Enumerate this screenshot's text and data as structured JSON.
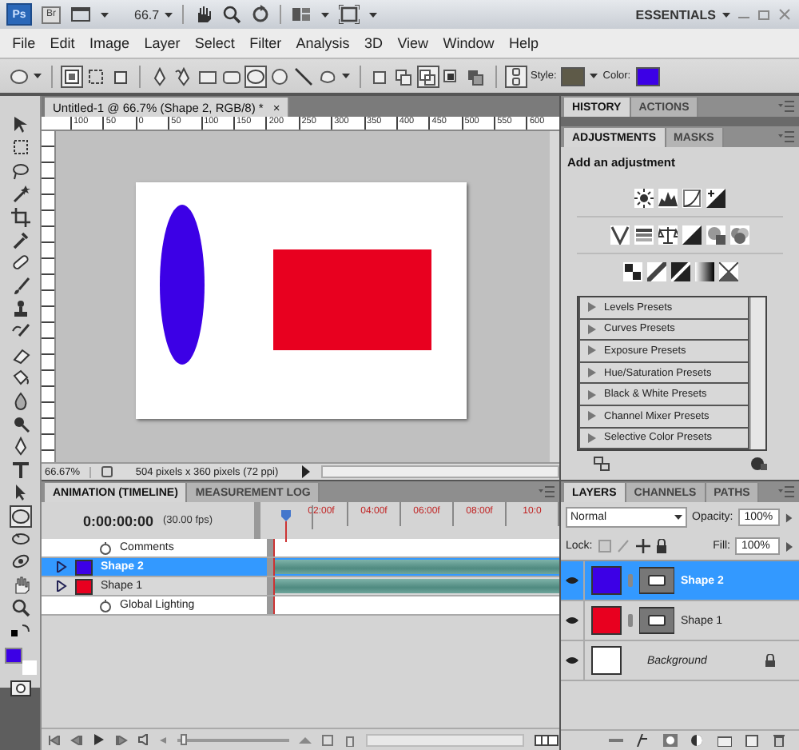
{
  "app_bar": {
    "logo": "Ps",
    "bridge": "Br",
    "zoom": "66.7",
    "workspace": "ESSENTIALS"
  },
  "menu": [
    "File",
    "Edit",
    "Image",
    "Layer",
    "Select",
    "Filter",
    "Analysis",
    "3D",
    "View",
    "Window",
    "Help"
  ],
  "options_bar": {
    "swatches": [
      {
        "label": "Style:",
        "color": "#5e5a48"
      },
      {
        "label": "Color:",
        "color": "#3c00e6"
      }
    ]
  },
  "toolbox": {
    "swatches": [
      {
        "color": "#3c00e6"
      },
      {
        "color": "#ffffff"
      }
    ]
  },
  "document": {
    "tab": "Untitled-1 @ 66.7% (Shape 2, RGB/8) *",
    "close": "×",
    "ruler": [
      "100",
      "50",
      "0",
      "50",
      "100",
      "150",
      "200",
      "250",
      "300",
      "350",
      "400",
      "450",
      "500",
      "550",
      "600"
    ],
    "zoom": "66.67%",
    "info": "504 pixels x 360 pixels (72 ppi)"
  },
  "timeline": {
    "tabs": [
      {
        "label": "ANIMATION (TIMELINE)",
        "selected": true
      },
      {
        "label": "MEASUREMENT LOG",
        "selected": false
      }
    ],
    "zoom_slider": {
      "level": 0.05
    },
    "time": "0:00:00:00",
    "fps": "(30.00 fps)",
    "ticks": [
      "02:00f",
      "04:00f",
      "06:00f",
      "08:00f",
      "10:0"
    ],
    "rows": [
      {
        "label": "Comments",
        "kind": "property",
        "selected": false
      },
      {
        "label": "Shape 2",
        "kind": "layer",
        "selected": true,
        "color": "#3c00e6"
      },
      {
        "label": "Shape 1",
        "kind": "layer",
        "selected": false,
        "color": "#e8001f"
      },
      {
        "label": "Global Lighting",
        "kind": "property",
        "selected": false
      }
    ]
  },
  "history": {
    "tabs": [
      {
        "label": "HISTORY",
        "selected": true
      },
      {
        "label": "ACTIONS",
        "selected": false
      }
    ]
  },
  "adjustments": {
    "tabs": [
      {
        "label": "ADJUSTMENTS",
        "selected": true
      },
      {
        "label": "MASKS",
        "selected": false
      }
    ],
    "heading": "Add an adjustment",
    "presets": [
      "Levels Presets",
      "Curves Presets",
      "Exposure Presets",
      "Hue/Saturation Presets",
      "Black & White Presets",
      "Channel Mixer Presets",
      "Selective Color Presets"
    ]
  },
  "layers": {
    "tabs": [
      {
        "label": "LAYERS",
        "selected": true
      },
      {
        "label": "CHANNELS",
        "selected": false
      },
      {
        "label": "PATHS",
        "selected": false
      }
    ],
    "blend_mode": "Normal",
    "opacity_label": "Opacity:",
    "opacity": "100%",
    "lock_label": "Lock:",
    "fill_label": "Fill:",
    "fill": "100%",
    "items": [
      {
        "name": "Shape 2",
        "kind": "shape",
        "selected": true,
        "color": "#3c00e6"
      },
      {
        "name": "Shape 1",
        "kind": "shape",
        "selected": false,
        "color": "#e8001f"
      },
      {
        "name": "Background",
        "kind": "background",
        "selected": false
      }
    ]
  }
}
